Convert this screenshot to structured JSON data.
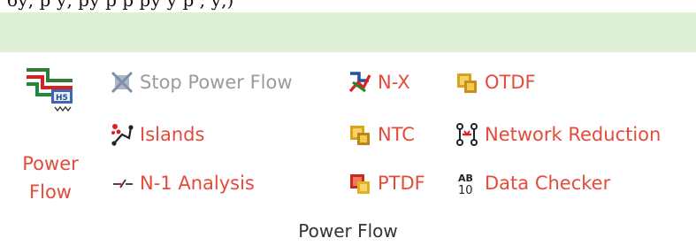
{
  "doc_fragment": "бу, р у,  ру р    р ру у р , у,)",
  "group": {
    "title": "Power Flow"
  },
  "big_button": {
    "label": "Power\nFlow",
    "icon": "power-flow-icon"
  },
  "commands": {
    "stop_power_flow": {
      "label": "Stop Power Flow",
      "icon": "stop-power-flow-icon",
      "enabled": false
    },
    "islands": {
      "label": "Islands",
      "icon": "islands-icon",
      "enabled": true
    },
    "n1_analysis": {
      "label": "N-1 Analysis",
      "icon": "n1-analysis-icon",
      "enabled": true
    },
    "nx": {
      "label": "N-X",
      "icon": "nx-icon",
      "enabled": true
    },
    "ntc": {
      "label": "NTC",
      "icon": "ntc-icon",
      "enabled": true
    },
    "ptdf": {
      "label": "PTDF",
      "icon": "ptdf-icon",
      "enabled": true
    },
    "otdf": {
      "label": "OTDF",
      "icon": "otdf-icon",
      "enabled": true
    },
    "network_reduction": {
      "label": "Network Reduction",
      "icon": "network-reduction-icon",
      "enabled": true
    },
    "data_checker": {
      "label": "Data Checker",
      "icon": "data-checker-icon",
      "enabled": true
    }
  },
  "colors": {
    "label": "#e44b3a",
    "disabled": "#9b9b9b",
    "ribbon": "#dff0d8",
    "group_title": "#333333"
  }
}
